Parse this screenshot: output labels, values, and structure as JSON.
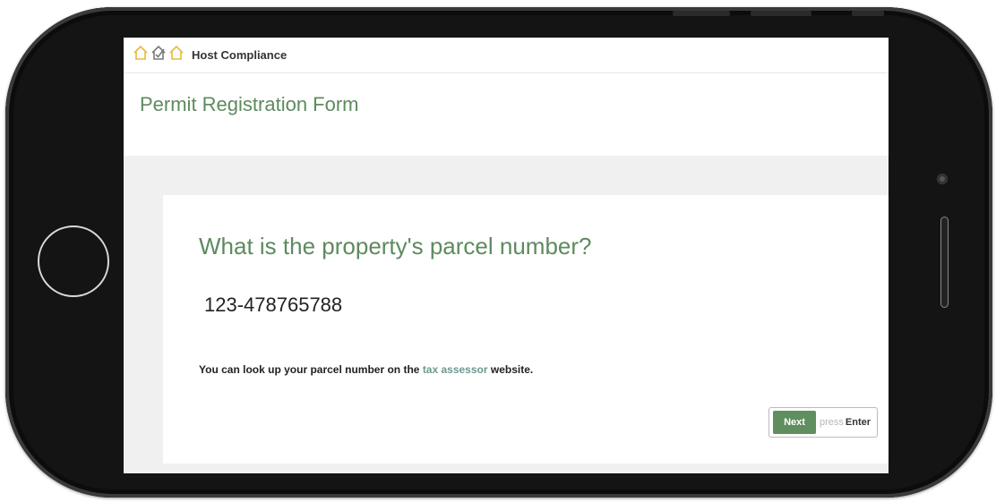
{
  "app": {
    "brand_name": "Host Compliance",
    "logo_icons": [
      "house-outline-icon",
      "house-check-icon",
      "house-outline-icon"
    ]
  },
  "form": {
    "title": "Permit Registration Form",
    "question": "What is the property's parcel number?",
    "answer_value": "123-478765788",
    "help_prefix": "You can look up your parcel number on the ",
    "help_link": "tax assessor",
    "help_suffix": " website.",
    "next_label": "Next",
    "press_text": "press",
    "enter_text": "Enter"
  },
  "colors": {
    "accent_green": "#5e8a5e",
    "button_green": "#5f8f5f",
    "link_teal": "#6a9a8f",
    "logo_yellow": "#e8b93c"
  }
}
